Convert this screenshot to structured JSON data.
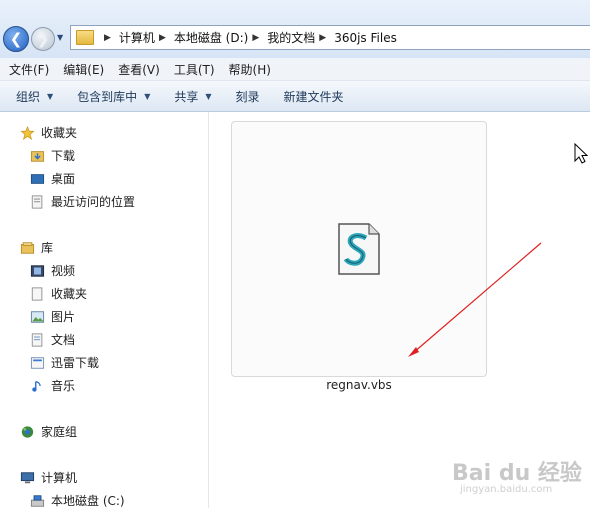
{
  "address": {
    "crumbs": [
      "计算机",
      "本地磁盘 (D:)",
      "我的文档",
      "360js Files"
    ]
  },
  "menu": [
    "文件(F)",
    "编辑(E)",
    "查看(V)",
    "工具(T)",
    "帮助(H)"
  ],
  "toolbar": {
    "organize": "组织",
    "include_in_library": "包含到库中",
    "share": "共享",
    "burn": "刻录",
    "new_folder": "新建文件夹"
  },
  "nav": {
    "favorites": "收藏夹",
    "downloads": "下载",
    "desktop": "桌面",
    "recent": "最近访问的位置",
    "libraries": "库",
    "videos": "视频",
    "lib_favorites": "收藏夹",
    "pictures": "图片",
    "documents": "文档",
    "xunlei": "迅雷下载",
    "music": "音乐",
    "homegroup": "家庭组",
    "computer": "计算机",
    "drive_c": "本地磁盘 (C:)"
  },
  "file": {
    "name": "regnav.vbs",
    "icon": "vbs-script-icon"
  },
  "watermark": {
    "brand": "Bai du 经验",
    "url": "jingyan.baidu.com"
  },
  "colors": {
    "accent": "#1f5fbf",
    "annotation_arrow": "#e02020"
  }
}
